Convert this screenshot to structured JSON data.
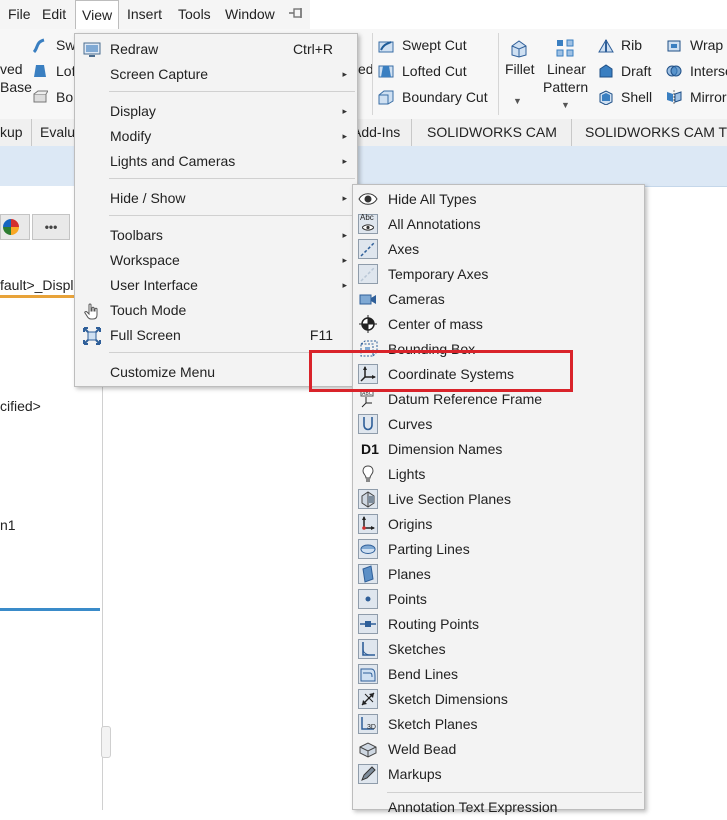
{
  "menubar": {
    "items": [
      "File",
      "Edit",
      "View",
      "Insert",
      "Tools",
      "Window"
    ],
    "pin_icon": "pin-icon"
  },
  "ribbon": {
    "left_partial": [
      "ved",
      "Base",
      "Sw",
      "Lof",
      "Bou"
    ],
    "cut_group": [
      "Swept Cut",
      "Lofted Cut",
      "Boundary Cut"
    ],
    "cut_partial": "ed",
    "fillet": "Fillet",
    "linear_pattern": [
      "Linear",
      "Pattern"
    ],
    "feature_group": [
      "Rib",
      "Draft",
      "Shell"
    ],
    "right_group": [
      "Wrap",
      "Interse",
      "Mirror"
    ]
  },
  "tabs": [
    "kup",
    "Evalu",
    "Add-Ins",
    "SOLIDWORKS CAM",
    "SOLIDWORKS CAM TI"
  ],
  "left_panel": {
    "more_button": "•••",
    "tree_text_1": "fault>_Displ",
    "tree_text_2": "cified>",
    "tree_text_3": "n1"
  },
  "view_menu": {
    "items": [
      {
        "label": "Redraw",
        "shortcut": "Ctrl+R",
        "icon": "redraw-icon"
      },
      {
        "label": "Screen Capture",
        "submenu": "▸"
      },
      {
        "label": "Display",
        "submenu": "▸"
      },
      {
        "label": "Modify",
        "submenu": "▸"
      },
      {
        "label": "Lights and Cameras",
        "submenu": "▸"
      },
      {
        "label": "Hide / Show",
        "submenu": "▸"
      },
      {
        "label": "Toolbars",
        "submenu": "▸"
      },
      {
        "label": "Workspace",
        "submenu": "▸"
      },
      {
        "label": "User Interface",
        "submenu": "▸"
      },
      {
        "label": "Touch Mode",
        "icon": "hand-icon"
      },
      {
        "label": "Full Screen",
        "shortcut": "F11",
        "icon": "full-screen-icon"
      },
      {
        "label": "Customize Menu"
      }
    ]
  },
  "hide_show_menu": {
    "highlighted": "Coordinate Systems",
    "highlight_color": "#d9232a",
    "items": [
      {
        "label": "Hide All Types",
        "icon": "eye-icon"
      },
      {
        "label": "All Annotations",
        "icon": "annotation-eye-icon",
        "icon_text": "Abc"
      },
      {
        "label": "Axes",
        "icon": "axes-icon"
      },
      {
        "label": "Temporary Axes",
        "icon": "temporary-axes-icon"
      },
      {
        "label": "Cameras",
        "icon": "camera-icon"
      },
      {
        "label": "Center of mass",
        "icon": "center-of-mass-icon"
      },
      {
        "label": "Bounding Box",
        "icon": "bounding-box-icon"
      },
      {
        "label": "Coordinate Systems",
        "icon": "coordinate-system-icon"
      },
      {
        "label": "Datum Reference Frame",
        "icon": "datum-reference-frame-icon"
      },
      {
        "label": "Curves",
        "icon": "curves-icon"
      },
      {
        "label": "Dimension Names",
        "icon": "dimension-names-icon",
        "icon_text": "D1"
      },
      {
        "label": "Lights",
        "icon": "light-bulb-icon"
      },
      {
        "label": "Live Section Planes",
        "icon": "live-section-planes-icon"
      },
      {
        "label": "Origins",
        "icon": "origins-icon"
      },
      {
        "label": "Parting Lines",
        "icon": "parting-lines-icon"
      },
      {
        "label": "Planes",
        "icon": "planes-icon"
      },
      {
        "label": "Points",
        "icon": "points-icon"
      },
      {
        "label": "Routing Points",
        "icon": "routing-points-icon"
      },
      {
        "label": "Sketches",
        "icon": "sketches-icon"
      },
      {
        "label": "Bend Lines",
        "icon": "bend-lines-icon"
      },
      {
        "label": "Sketch Dimensions",
        "icon": "sketch-dimensions-icon"
      },
      {
        "label": "Sketch Planes",
        "icon": "sketch-planes-icon",
        "icon_text": "3D"
      },
      {
        "label": "Weld Bead",
        "icon": "weld-bead-icon"
      },
      {
        "label": "Markups",
        "icon": "markups-icon"
      },
      {
        "label": "Annotation Text Expression",
        "icon": ""
      }
    ]
  }
}
